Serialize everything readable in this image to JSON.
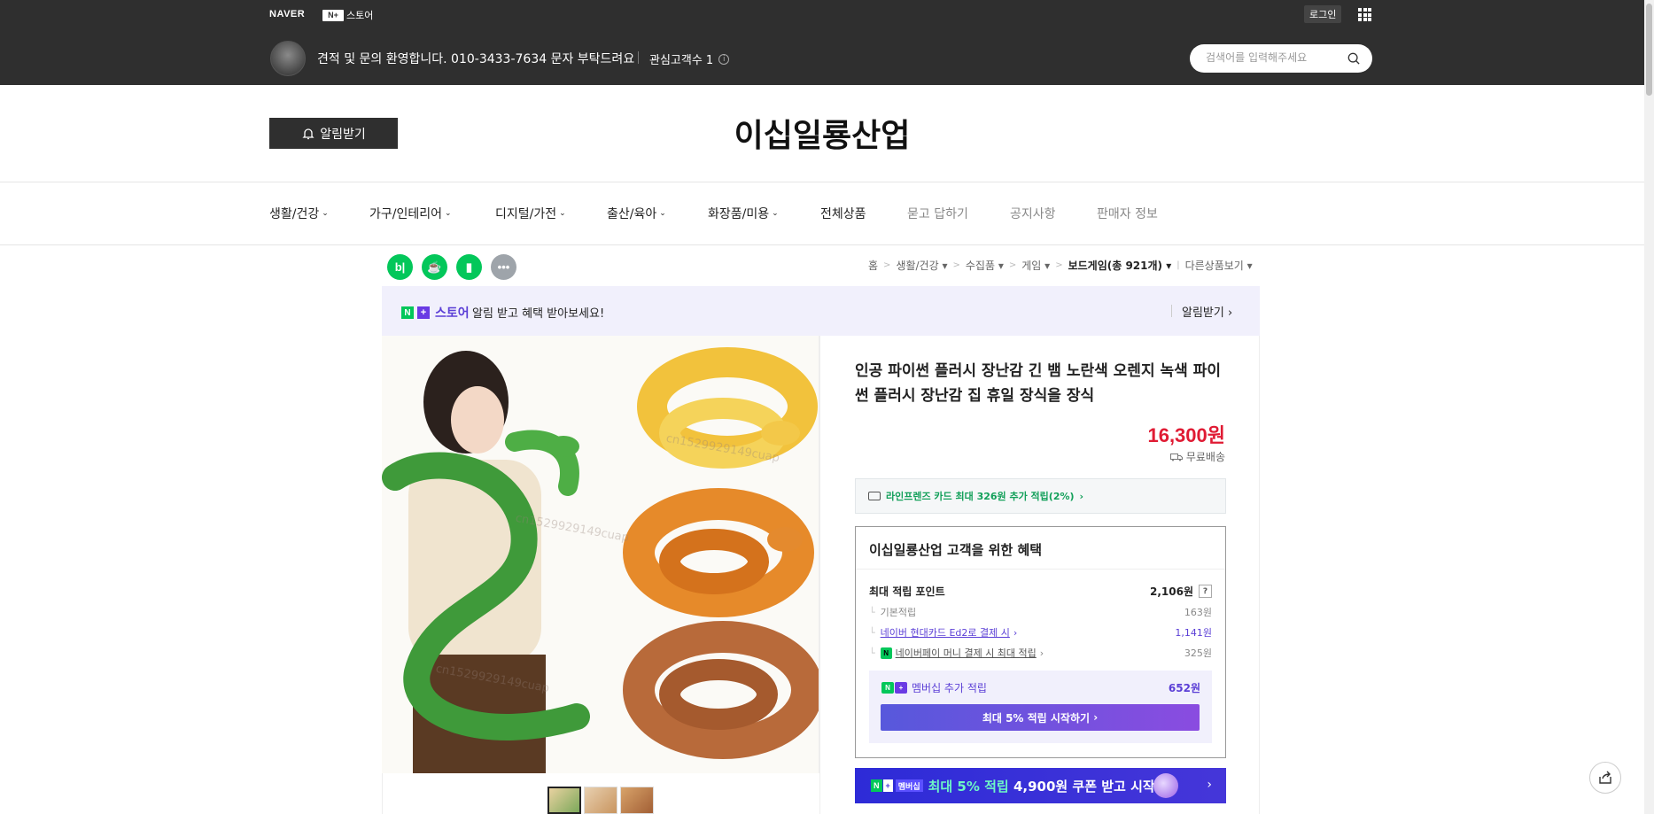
{
  "gnb": {
    "naver_logo": "NAVER",
    "store_badge": "N+",
    "store_label": "스토어",
    "login": "로그인"
  },
  "seller_bar": {
    "message": "견적 및 문의 환영합니다. 010-3433-7634 문자 부탁드려요",
    "fan_count": "관심고객수 1",
    "info_glyph": "i",
    "search_placeholder": "검색어를 입력해주세요"
  },
  "store": {
    "alarm_button": "알림받기",
    "title": "이십일룡산업"
  },
  "menu": [
    {
      "label": "생활/건강",
      "has_dropdown": true
    },
    {
      "label": "가구/인테리어",
      "has_dropdown": true
    },
    {
      "label": "디지털/가전",
      "has_dropdown": true
    },
    {
      "label": "출산/육아",
      "has_dropdown": true
    },
    {
      "label": "화장품/미용",
      "has_dropdown": true
    },
    {
      "label": "전체상품",
      "has_dropdown": false
    },
    {
      "label": "묻고 답하기",
      "has_dropdown": false
    },
    {
      "label": "공지사항",
      "has_dropdown": false
    },
    {
      "label": "판매자 정보",
      "has_dropdown": false
    }
  ],
  "share_buttons": [
    {
      "icon": "blog-icon",
      "glyph": "b|",
      "color": "#03c75a"
    },
    {
      "icon": "cafe-icon",
      "glyph": "☕",
      "color": "#03c75a"
    },
    {
      "icon": "bookmark-icon",
      "glyph": "▮",
      "color": "#03c75a"
    },
    {
      "icon": "more-icon",
      "glyph": "•••",
      "color": "#9ea4aa"
    }
  ],
  "breadcrumb": {
    "home": "홈",
    "c1": "생활/건강",
    "c2": "수집품",
    "c3": "게임",
    "c4": "보드게임(총 921개)",
    "other": "다른상품보기"
  },
  "promo": {
    "store_label": "스토어",
    "text": "알림 받고 혜택 받아보세요!",
    "alarm": "알림받기"
  },
  "product": {
    "title": "인공 파이썬 플러시 장난감 긴 뱀 노란색 오렌지 녹색 파이썬 플러시 장난감 집 휴일 장식을 장식",
    "price": "16,300원",
    "shipping": "무료배송",
    "card_benefit": "라인프렌즈 카드 최대 326원 추가 적립(2%)",
    "watermark": "cn1529929149cuap"
  },
  "benefits": {
    "title": "이십일룡산업 고객을 위한 혜택",
    "max_points_label": "최대 적립 포인트",
    "max_points_value": "2,106원",
    "help_glyph": "?",
    "basic_label": "기본적립",
    "basic_value": "163원",
    "card_label": "네이버 현대카드 Ed2로 결제 시",
    "card_value": "1,141원",
    "npay_glyph": "N",
    "pay_label": "네이버페이 머니 결제 시 최대 적립",
    "pay_value": "325원",
    "member_label": "멤버십 추가 적립",
    "member_value": "652원",
    "start_button": "최대 5% 적립 시작하기"
  },
  "coupon_banner": {
    "n": "N",
    "plus": "+",
    "badge": "멤버십",
    "text_highlight": "최대 5% 적립",
    "text_rest": "4,900원 쿠폰 받고 시작"
  }
}
